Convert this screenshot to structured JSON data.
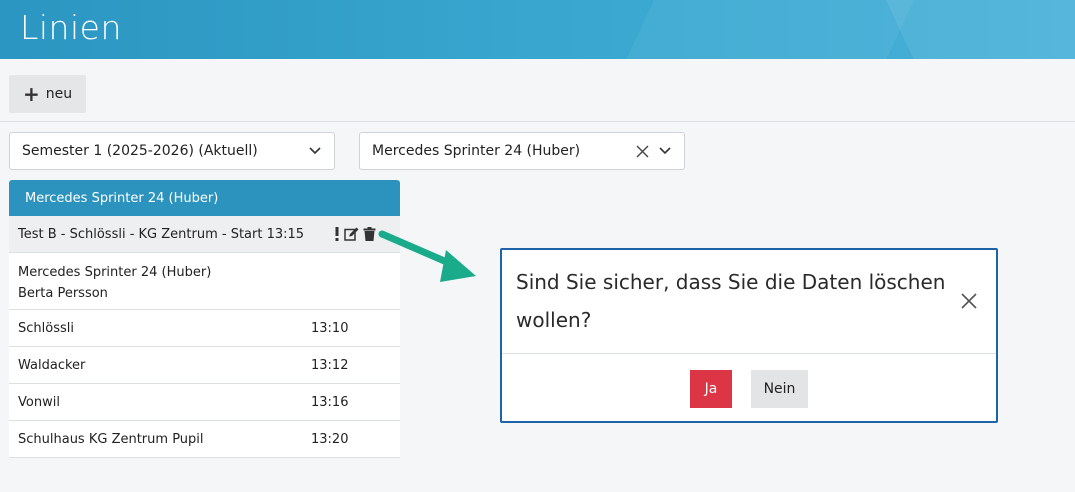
{
  "header": {
    "title": "Linien"
  },
  "toolbar": {
    "new_label": "neu"
  },
  "filters": {
    "semester": "Semester 1 (2025-2026) (Aktuell)",
    "vehicle": "Mercedes Sprinter 24 (Huber)"
  },
  "card": {
    "title": "Mercedes Sprinter 24 (Huber)",
    "route": "Test B - Schlössli - KG Zentrum - Start 13:15",
    "info_line1": "Mercedes Sprinter 24 (Huber)",
    "info_line2": "Berta Persson",
    "stops": [
      {
        "name": "Schlössli",
        "time": "13:10"
      },
      {
        "name": "Waldacker",
        "time": "13:12"
      },
      {
        "name": "Vonwil",
        "time": "13:16"
      },
      {
        "name": "Schulhaus KG Zentrum Pupil",
        "time": "13:20"
      }
    ]
  },
  "modal": {
    "message": "Sind Sie sicher, dass Sie die Daten löschen wollen?",
    "yes_label": "Ja",
    "no_label": "Nein"
  },
  "colors": {
    "header": "#2b96c1",
    "card_head": "#2b93bd",
    "danger": "#dc3545",
    "modal_border": "#1e62a8",
    "arrow": "#1aab8a"
  }
}
